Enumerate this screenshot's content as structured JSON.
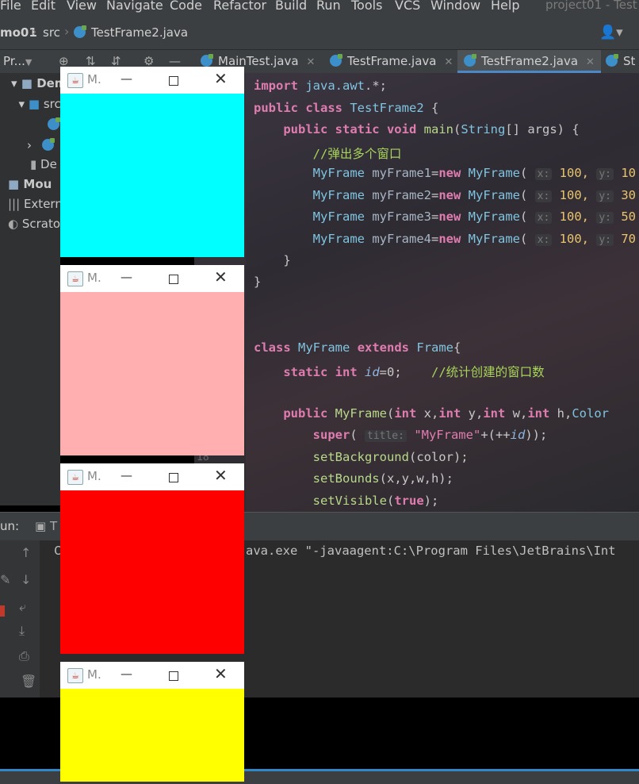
{
  "menu": [
    "File",
    "Edit",
    "View",
    "Navigate",
    "Code",
    "Refactor",
    "Build",
    "Run",
    "Tools",
    "VCS",
    "Window",
    "Help"
  ],
  "window_title": "project01 - Test",
  "breadcrumb": {
    "project": "mo01",
    "folder": "src",
    "file": "TestFrame2.java"
  },
  "project_panel": {
    "label": "Pr...",
    "items": [
      "Demo",
      "src",
      "De",
      "Mou",
      "Extern",
      "Scrato"
    ]
  },
  "tabs": [
    {
      "label": "MainTest.java",
      "active": false
    },
    {
      "label": "TestFrame.java",
      "active": false
    },
    {
      "label": "TestFrame2.java",
      "active": true
    },
    {
      "label": "St",
      "active": false
    }
  ],
  "code": {
    "gutter_number": "18",
    "hint_x": "x:",
    "hint_y": "y:",
    "hint_title": "title:",
    "x_val": "100,",
    "y_vals": [
      "10",
      "30",
      "50",
      "70"
    ]
  },
  "run": {
    "label": "un:",
    "output": "ava.exe \"-javaagent:C:\\Program Files\\JetBrains\\Int"
  },
  "frames": [
    {
      "title": "M.",
      "color": "#00ffff"
    },
    {
      "title": "M.",
      "color": "#ffafaf"
    },
    {
      "title": "M.",
      "color": "#ff0000"
    },
    {
      "title": "M.",
      "color": "#ffff00"
    }
  ],
  "colors": {
    "accent": "#2f88c9"
  }
}
